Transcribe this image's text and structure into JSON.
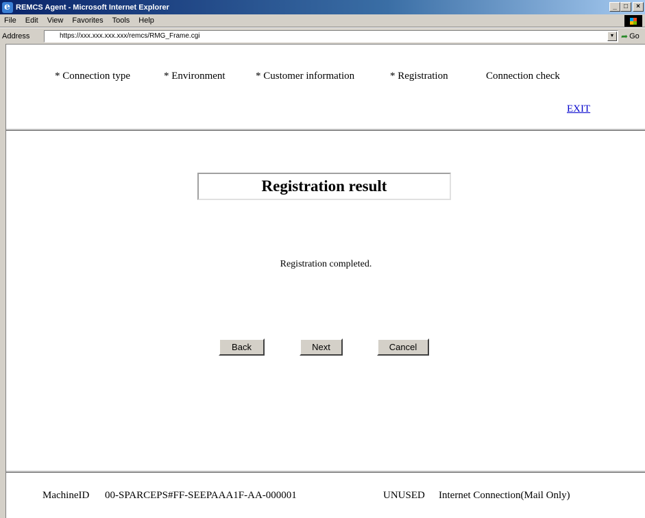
{
  "window": {
    "title": "REMCS Agent - Microsoft Internet Explorer",
    "controls": {
      "minimize": "_",
      "maximize": "□",
      "close": "×"
    }
  },
  "menu": {
    "items": [
      "File",
      "Edit",
      "View",
      "Favorites",
      "Tools",
      "Help"
    ]
  },
  "address_bar": {
    "label": "Address",
    "url": "https://xxx.xxx.xxx.xxx/remcs/RMG_Frame.cgi",
    "go_label": "Go"
  },
  "steps": [
    "* Connection type",
    "* Environment",
    "* Customer information",
    "* Registration",
    "Connection check"
  ],
  "exit_label": "EXIT",
  "main": {
    "heading": "Registration result",
    "message": "Registration completed.",
    "buttons": {
      "back": "Back",
      "next": "Next",
      "cancel": "Cancel"
    }
  },
  "footer": {
    "machine_id_label": "MachineID",
    "machine_id": "00-SPARCEPS#FF-SEEPAAA1F-AA-000001",
    "status": "UNUSED",
    "connection": "Internet Connection(Mail Only)"
  },
  "icons": [
    "ie-app-icon",
    "windows-logo-icon",
    "dropdown-arrow-icon",
    "go-arrow-icon"
  ]
}
